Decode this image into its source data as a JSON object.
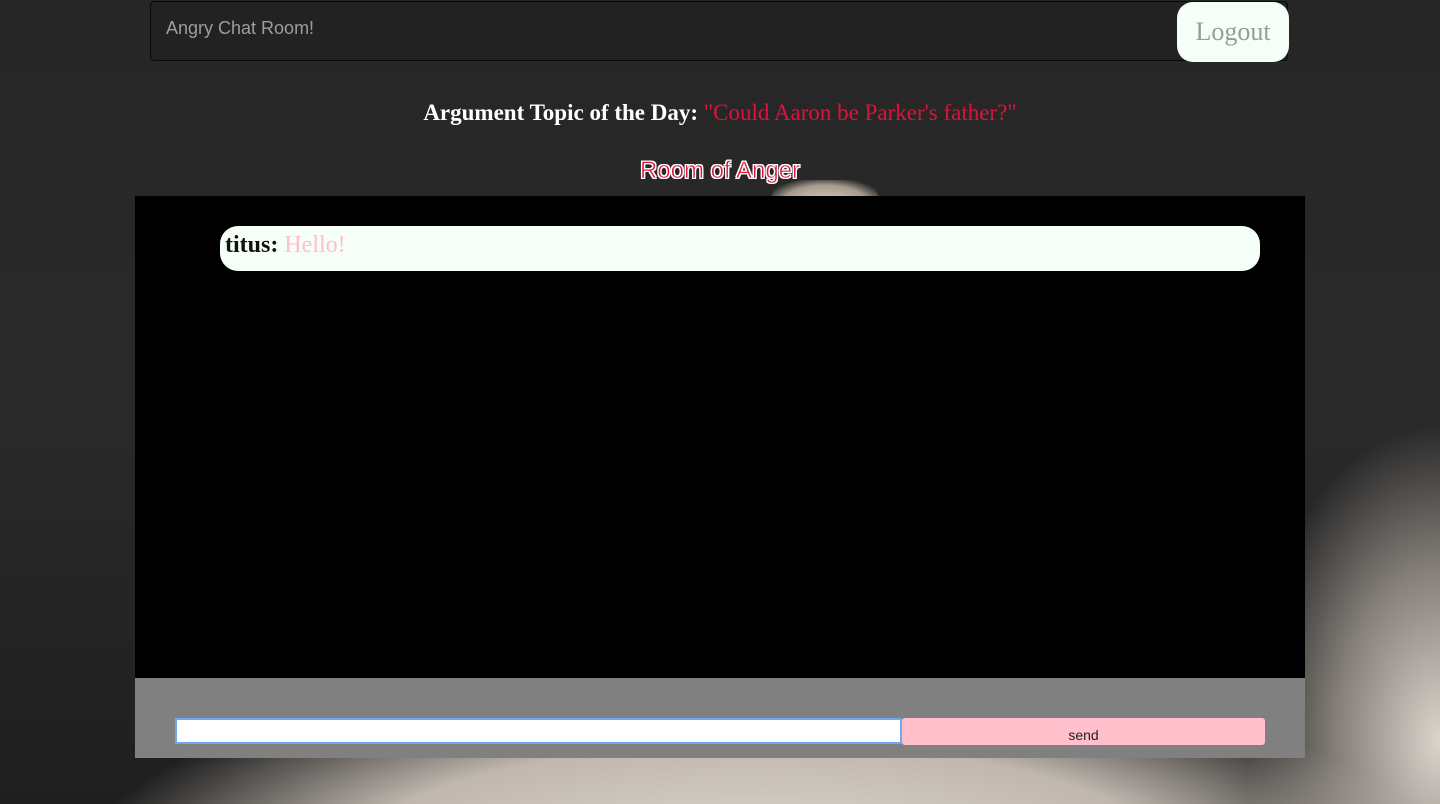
{
  "navbar": {
    "brand": "Angry Chat Room!",
    "logout_label": "Logout"
  },
  "topic": {
    "prefix": "Argument Topic of the Day:",
    "quote": "\"Could Aaron be Parker's father?\""
  },
  "room": {
    "title": "Room of Anger"
  },
  "messages": [
    {
      "user": "titus:",
      "text": "Hello!"
    }
  ],
  "composer": {
    "input_value": "",
    "send_label": "send"
  },
  "colors": {
    "accent_red": "#dc143c",
    "pink": "#ffc0cb",
    "bubble": "#f5fff8"
  }
}
